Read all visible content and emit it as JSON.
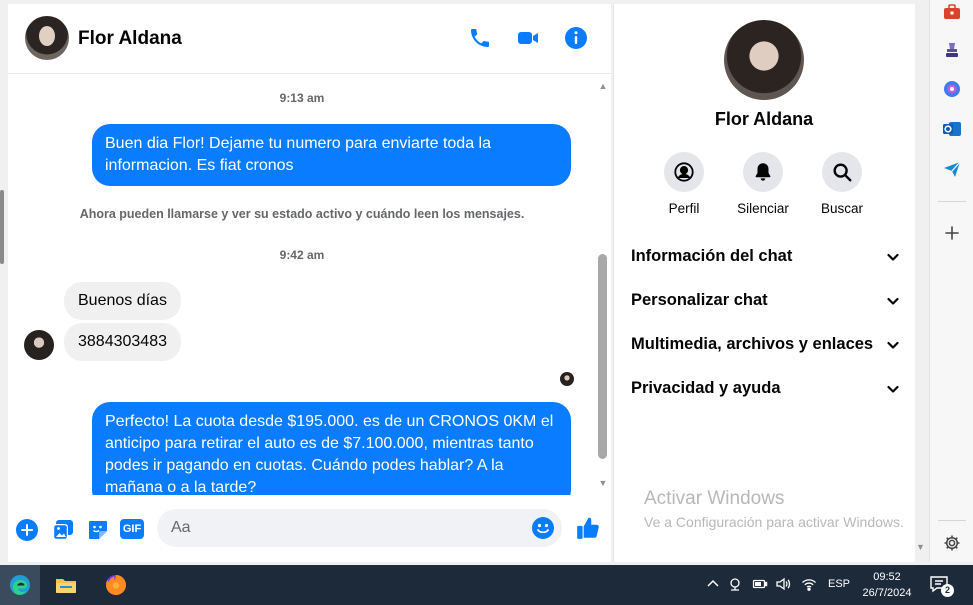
{
  "header": {
    "contact_name": "Flor Aldana"
  },
  "messages": {
    "time_1": "9:13 am",
    "out_1": "Buen dia Flor! Dejame tu numero para enviarte toda la informacion. Es fiat cronos",
    "notice": "Ahora pueden llamarse y ver su estado activo y cuándo leen los mensajes.",
    "time_2": "9:42 am",
    "in_1": "Buenos días",
    "in_2": "3884303483",
    "out_2": "Perfecto! La cuota desde $195.000. es de un CRONOS 0KM el anticipo para retirar el auto es de $7.100.000, mientras tanto podes ir pagando en cuotas. Cuándo podes hablar? A la mañana o a la tarde?"
  },
  "composer": {
    "gif_label": "GIF",
    "placeholder": "Aa"
  },
  "panel": {
    "name": "Flor Aldana",
    "actions": [
      {
        "label": "Perfil",
        "icon": "profile-icon"
      },
      {
        "label": "Silenciar",
        "icon": "bell-icon"
      },
      {
        "label": "Buscar",
        "icon": "search-icon"
      }
    ],
    "sections": [
      "Información del chat",
      "Personalizar chat",
      "Multimedia, archivos y enlaces",
      "Privacidad y ayuda"
    ],
    "watermark_title": "Activar Windows",
    "watermark_sub": "Ve a Configuración para activar Windows."
  },
  "taskbar": {
    "language": "ESP",
    "time": "09:52",
    "date": "26/7/2024",
    "notifications": "2"
  },
  "colors": {
    "accent": "#0a7cff",
    "taskbar": "#1c2a3a"
  }
}
